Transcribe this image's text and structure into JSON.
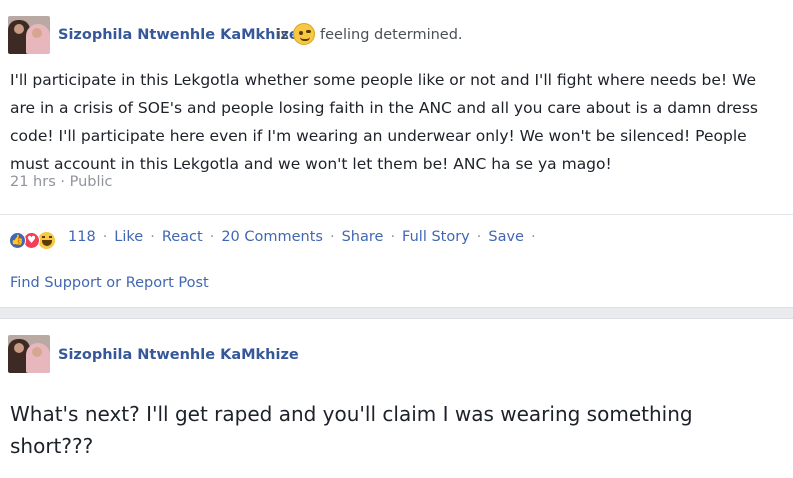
{
  "posts": [
    {
      "author": "Sizophila Ntwenhle KaMkhize",
      "is_word": "is",
      "feeling_text": "feeling determined.",
      "body": "I'll participate in this Lekgotla whether some people like or not and I'll fight where needs be! We are in a crisis of SOE's  and people losing faith in the ANC and all you care about is a damn dress code! I'll participate here even if I'm wearing an underwear only! We won't be silenced! People must account in this Lekgotla and we won't let them be! ANC ha se ya mago!",
      "timestamp": "21 hrs",
      "meta_sep": "·",
      "privacy": "Public",
      "reaction_count": "118",
      "actions": {
        "like": "Like",
        "react": "React",
        "comments": "20 Comments",
        "share": "Share",
        "full_story": "Full Story",
        "save": "Save"
      },
      "separator": "·",
      "report_link": "Find Support or Report Post"
    },
    {
      "author": "Sizophila Ntwenhle KaMkhize",
      "body": "What's next? I'll get raped and you'll claim I was wearing something short???"
    }
  ],
  "icons": {
    "feeling_emoji": "winking-face-icon",
    "reactions": [
      "like-reaction-icon",
      "love-reaction-icon",
      "haha-reaction-icon"
    ]
  },
  "colors": {
    "link_blue": "#4267b2",
    "name_blue": "#365899",
    "text": "#1d2129",
    "muted": "#90949c",
    "background": "#e9ebee"
  }
}
